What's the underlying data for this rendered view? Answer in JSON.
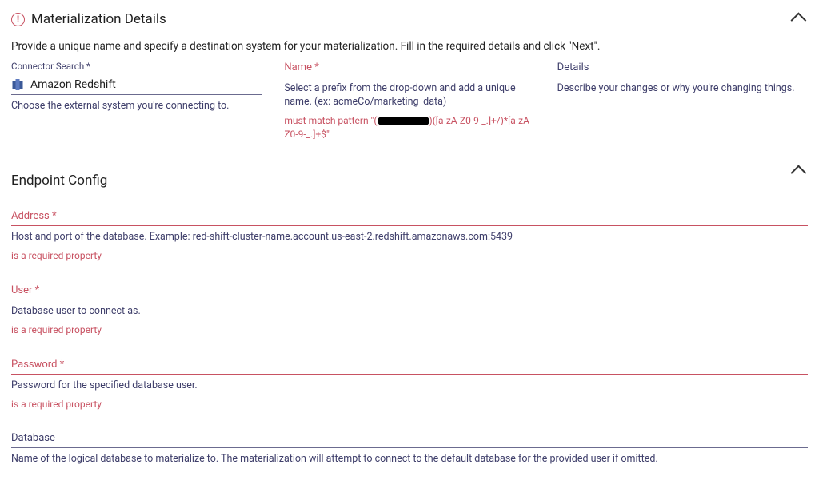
{
  "materialization": {
    "title": "Materialization Details",
    "description": "Provide a unique name and specify a destination system for your materialization. Fill in the required details and click \"Next\".",
    "connector": {
      "search_label": "Connector Search",
      "name": "Amazon Redshift",
      "helper": "Choose the external system you're connecting to."
    },
    "name_field": {
      "label": "Name",
      "helper": "Select a prefix from the drop-down and add a unique name. (ex: acmeCo/marketing_data)",
      "error_prefix": "must match pattern \"(",
      "error_suffix": ")([a-zA-Z0-9-_.]+/)*[a-zA-Z0-9-_.]+$\""
    },
    "details_field": {
      "label": "Details",
      "helper": "Describe your changes or why you're changing things."
    }
  },
  "endpoint": {
    "title": "Endpoint Config",
    "fields": {
      "address": {
        "label": "Address",
        "helper": "Host and port of the database. Example: red-shift-cluster-name.account.us-east-2.redshift.amazonaws.com:5439",
        "error": "is a required property"
      },
      "user": {
        "label": "User",
        "helper": "Database user to connect as.",
        "error": "is a required property"
      },
      "password": {
        "label": "Password",
        "helper": "Password for the specified database user.",
        "error": "is a required property"
      },
      "database": {
        "label": "Database",
        "helper": "Name of the logical database to materialize to. The materialization will attempt to connect to the default database for the provided user if omitted."
      }
    }
  }
}
